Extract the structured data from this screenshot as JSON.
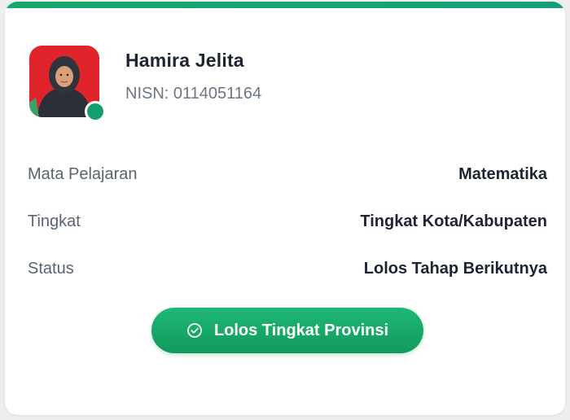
{
  "student": {
    "name": "Hamira Jelita",
    "nisn": "NISN: 0114051164",
    "avatar_icon": "student-photo",
    "online_status_color": "#14a06e"
  },
  "details": [
    {
      "label": "Mata Pelajaran",
      "value": "Matematika"
    },
    {
      "label": "Tingkat",
      "value": "Tingkat Kota/Kabupaten"
    },
    {
      "label": "Status",
      "value": "Lolos Tahap Berikutnya"
    }
  ],
  "action": {
    "label": "Lolos Tingkat Provinsi",
    "icon": "check-circle-icon",
    "color": "#16a86a"
  },
  "colors": {
    "accent": "#16a86a",
    "avatar_background": "#e0242b"
  }
}
